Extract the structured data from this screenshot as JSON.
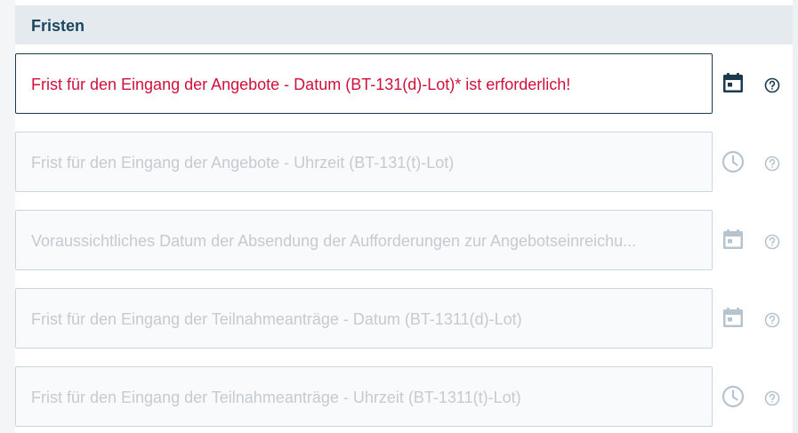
{
  "section": {
    "title": "Fristen"
  },
  "fields": [
    {
      "label": "Frist für den Eingang der Angebote - Datum (BT-131(d)-Lot)* ist erforderlich!",
      "icon": "calendar-icon",
      "state": "error"
    },
    {
      "label": "Frist für den Eingang der Angebote - Uhrzeit (BT-131(t)-Lot)",
      "icon": "clock-icon",
      "state": "disabled"
    },
    {
      "label": "Voraussichtliches Datum der Absendung der Aufforderungen zur Angebotseinreichu...",
      "icon": "calendar-icon",
      "state": "disabled"
    },
    {
      "label": "Frist für den Eingang der Teilnahmeanträge - Datum (BT-1311(d)-Lot)",
      "icon": "calendar-icon",
      "state": "disabled"
    },
    {
      "label": "Frist für den Eingang der Teilnahmeanträge - Uhrzeit (BT-1311(t)-Lot)",
      "icon": "clock-icon",
      "state": "disabled"
    }
  ],
  "help_icon": "help-circle-icon",
  "colors": {
    "header_text": "#1b4660",
    "error_text": "#d0103a",
    "active_icon": "#1b3a4b",
    "disabled_icon": "#b5c4ce",
    "disabled_text": "#c4cbd1"
  }
}
